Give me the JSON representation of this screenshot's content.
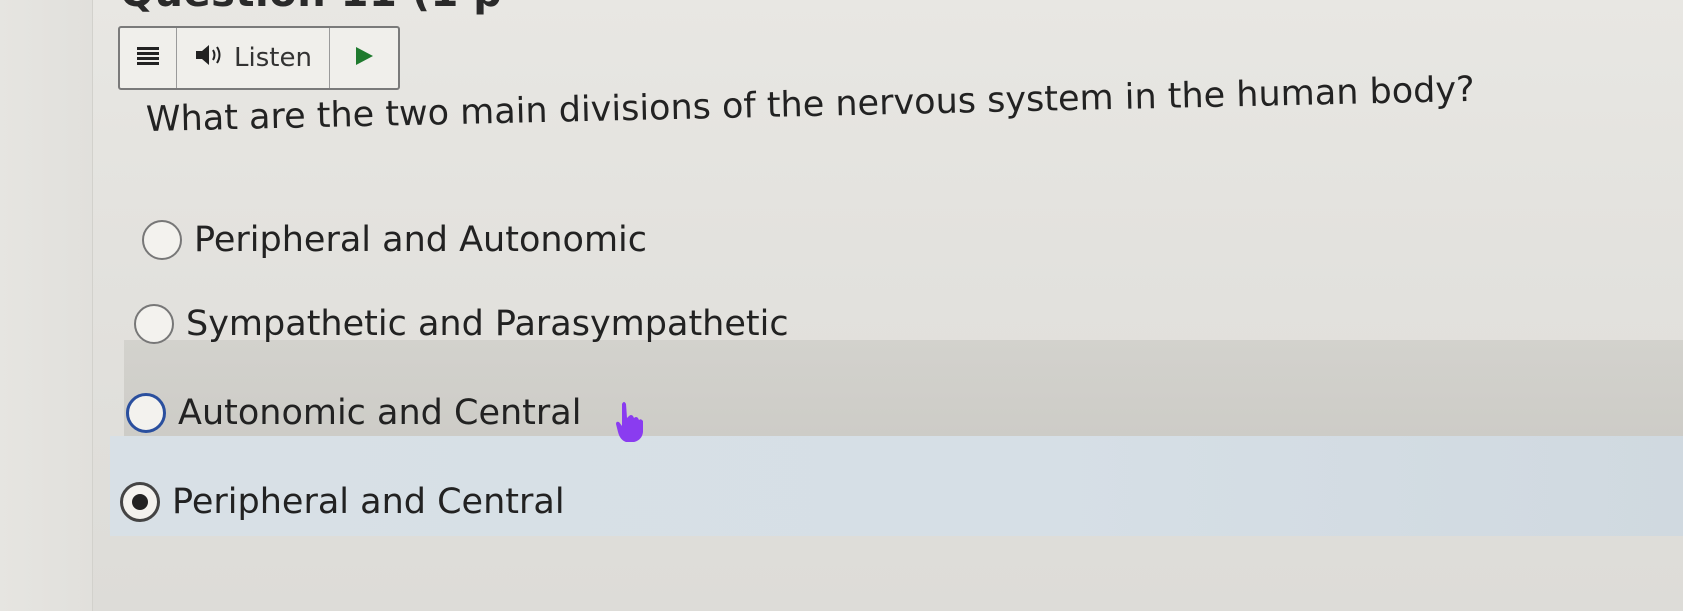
{
  "question": {
    "header_partial": "Question 11 (1 p",
    "text": "What are the two main divisions of the nervous system in the human body?"
  },
  "toolbar": {
    "menu_icon": "menu-lines-icon",
    "listen_icon": "speaker-icon",
    "listen_label": "Listen",
    "play_icon": "play-triangle-icon"
  },
  "options": [
    {
      "label": "Peripheral and Autonomic",
      "selected": false
    },
    {
      "label": "Sympathetic and Parasympathetic",
      "selected": false
    },
    {
      "label": "Autonomic and Central",
      "selected": false,
      "hovered": true
    },
    {
      "label": "Peripheral and Central",
      "selected": true
    }
  ],
  "colors": {
    "hover_band": "#cfcec9",
    "selected_band": "#d6dfe6",
    "focus_ring": "#2a4f9e",
    "cursor": "#8a3cf0",
    "play_icon": "#1f7a2e"
  }
}
